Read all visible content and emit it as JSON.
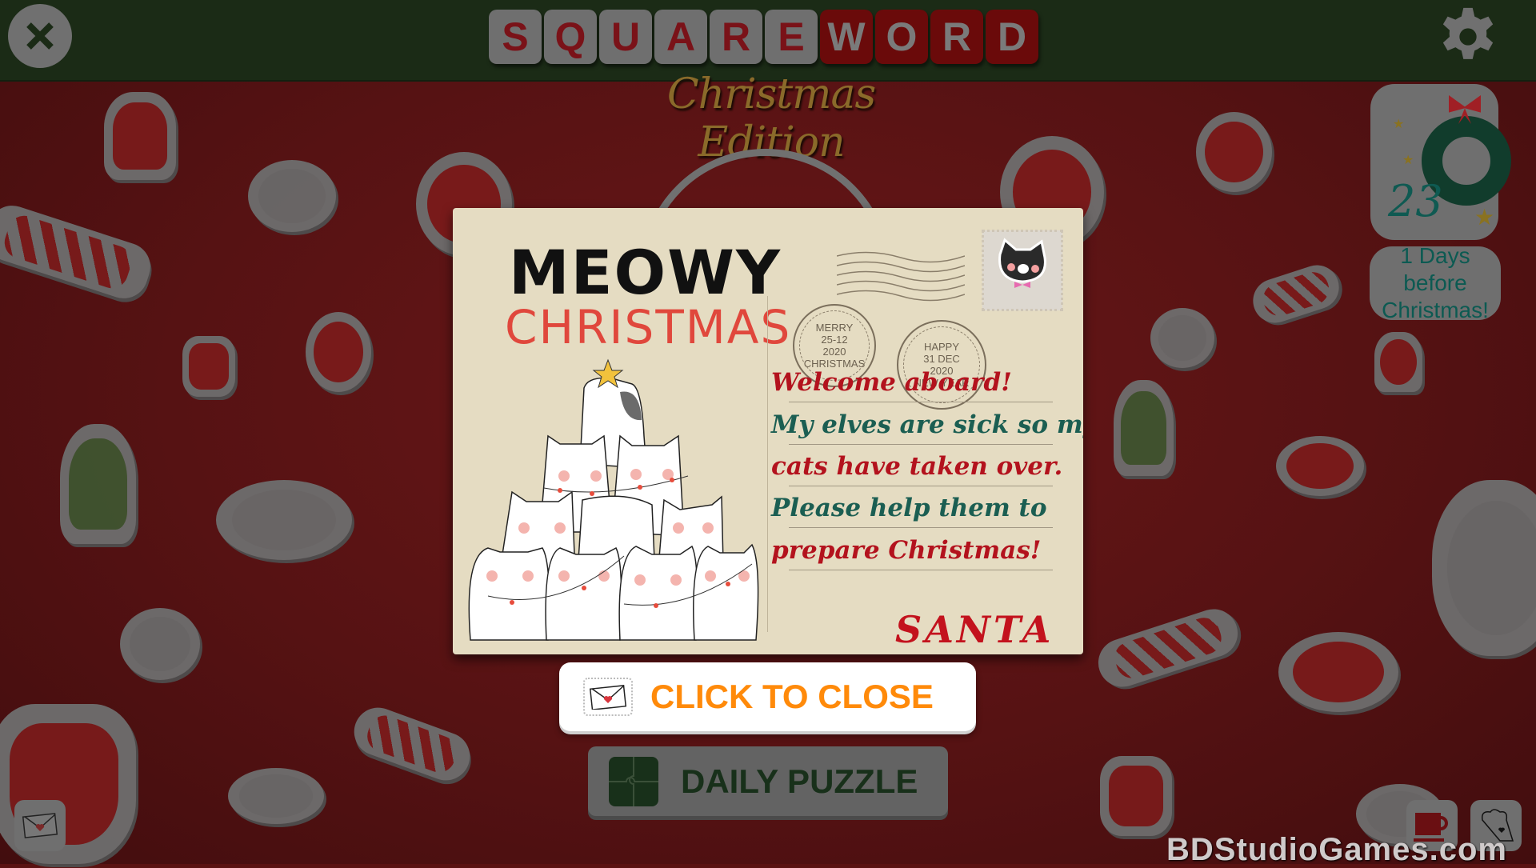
{
  "header": {
    "title_letters": [
      "S",
      "Q",
      "U",
      "A",
      "R",
      "E",
      "W",
      "O",
      "R",
      "D"
    ],
    "title_grey_count": 6,
    "subtitle": "Christmas Edition",
    "close_icon": "close-x-icon",
    "settings_icon": "gear-icon"
  },
  "advent": {
    "day": "23",
    "icon": "wreath-icon",
    "days_left_line1": "1 Days before",
    "days_left_line2": "Christmas!"
  },
  "postcard": {
    "heading_line1": "MEOWY",
    "heading_line2": "CHRISTMAS",
    "postmark1": {
      "top": "MERRY",
      "date": "25-12",
      "year": "2020",
      "bottom": "CHRISTMAS"
    },
    "postmark2": {
      "top": "HAPPY",
      "date": "31 DEC",
      "year": "2020",
      "bottom": "NEW YEAR"
    },
    "stamp_icon": "black-cat-stamp-icon",
    "message": [
      {
        "text": "Welcome aboard!",
        "color": "red"
      },
      {
        "text": "My elves are sick so my",
        "color": "green"
      },
      {
        "text": "cats have taken over.",
        "color": "red"
      },
      {
        "text": "Please help them to",
        "color": "green"
      },
      {
        "text": "prepare Christmas!",
        "color": "red"
      }
    ],
    "signature": "SANTA"
  },
  "buttons": {
    "close_label": "CLICK TO CLOSE",
    "daily_label": "DAILY PUZZLE"
  },
  "colors": {
    "header_bg": "#1b2b16",
    "background": "#561213",
    "close_text": "#ff8a0a",
    "message_red": "#b3121d",
    "message_green": "#1b5e52"
  },
  "watermark": "BDStudioGames.com"
}
